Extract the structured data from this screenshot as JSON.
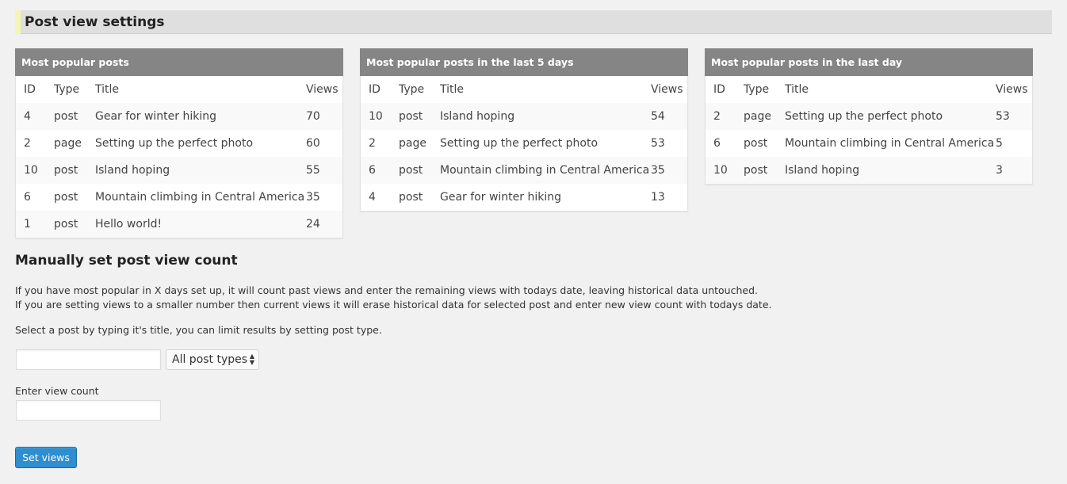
{
  "page": {
    "title": "Post view settings"
  },
  "colors": {
    "background": "#f1f1f1",
    "header_bar": "#dfdfdf",
    "header_accent": "#f2f5b5",
    "panel_header": "#858585",
    "button": "#2e8ecf"
  },
  "panels": [
    {
      "title": "Most popular posts",
      "columns": [
        "ID",
        "Type",
        "Title",
        "Views"
      ],
      "rows": [
        [
          "4",
          "post",
          "Gear for winter hiking",
          "70"
        ],
        [
          "2",
          "page",
          "Setting up the perfect photo",
          "60"
        ],
        [
          "10",
          "post",
          "Island hoping",
          "55"
        ],
        [
          "6",
          "post",
          "Mountain climbing in Central America",
          "35"
        ],
        [
          "1",
          "post",
          "Hello world!",
          "24"
        ]
      ]
    },
    {
      "title": "Most popular posts in the last 5 days",
      "columns": [
        "ID",
        "Type",
        "Title",
        "Views"
      ],
      "rows": [
        [
          "10",
          "post",
          "Island hoping",
          "54"
        ],
        [
          "2",
          "page",
          "Setting up the perfect photo",
          "53"
        ],
        [
          "6",
          "post",
          "Mountain climbing in Central America",
          "35"
        ],
        [
          "4",
          "post",
          "Gear for winter hiking",
          "13"
        ]
      ]
    },
    {
      "title": "Most popular posts in the last day",
      "columns": [
        "ID",
        "Type",
        "Title",
        "Views"
      ],
      "rows": [
        [
          "2",
          "page",
          "Setting up the perfect photo",
          "53"
        ],
        [
          "6",
          "post",
          "Mountain climbing in Central America",
          "5"
        ],
        [
          "10",
          "post",
          "Island hoping",
          "3"
        ]
      ]
    }
  ],
  "manual": {
    "title": "Manually set post view count",
    "description_1": "If you have most popular in X days set up, it will count past views and enter the remaining views with todays date, leaving historical data untouched.",
    "description_2": "If you are setting views to a smaller number then current views it will erase historical data for selected post and enter new view count with todays date.",
    "description_3": "Select a post by typing it's title, you can limit results by setting post type.",
    "post_search_value": "",
    "post_type_select": {
      "selected": "All post types",
      "arrow_icon": "select-arrows-icon"
    },
    "view_count_label": "Enter view count",
    "view_count_value": "",
    "button_label": "Set views"
  }
}
